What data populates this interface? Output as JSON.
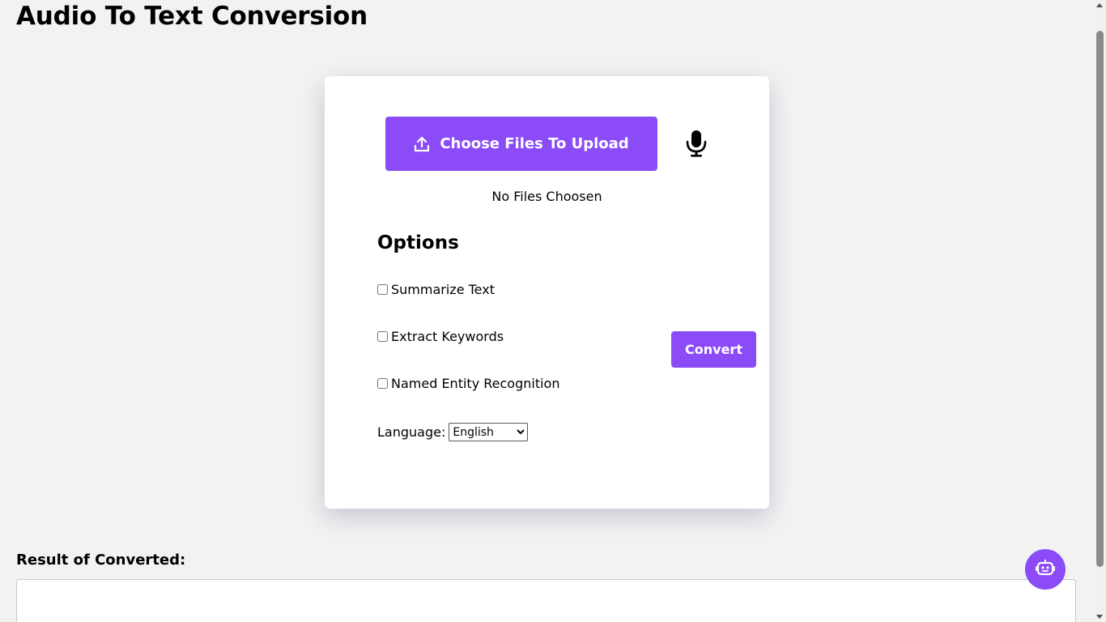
{
  "page": {
    "title": "Audio To Text Conversion"
  },
  "upload": {
    "button_label": "Choose Files To Upload",
    "status": "No Files Choosen"
  },
  "options": {
    "heading": "Options",
    "items": [
      {
        "label": "Summarize Text",
        "checked": false
      },
      {
        "label": "Extract Keywords",
        "checked": false
      },
      {
        "label": "Named Entity Recognition",
        "checked": false
      }
    ],
    "language_label": "Language:",
    "language_selected": "English"
  },
  "convert": {
    "button_label": "Convert"
  },
  "result": {
    "label": "Result of Converted:",
    "value": ""
  },
  "colors": {
    "accent": "#8b4cf7",
    "background": "#f2f2f2",
    "card": "#ffffff"
  },
  "icons": {
    "upload": "upload-icon",
    "microphone": "microphone-icon",
    "chatbot": "robot-icon"
  }
}
